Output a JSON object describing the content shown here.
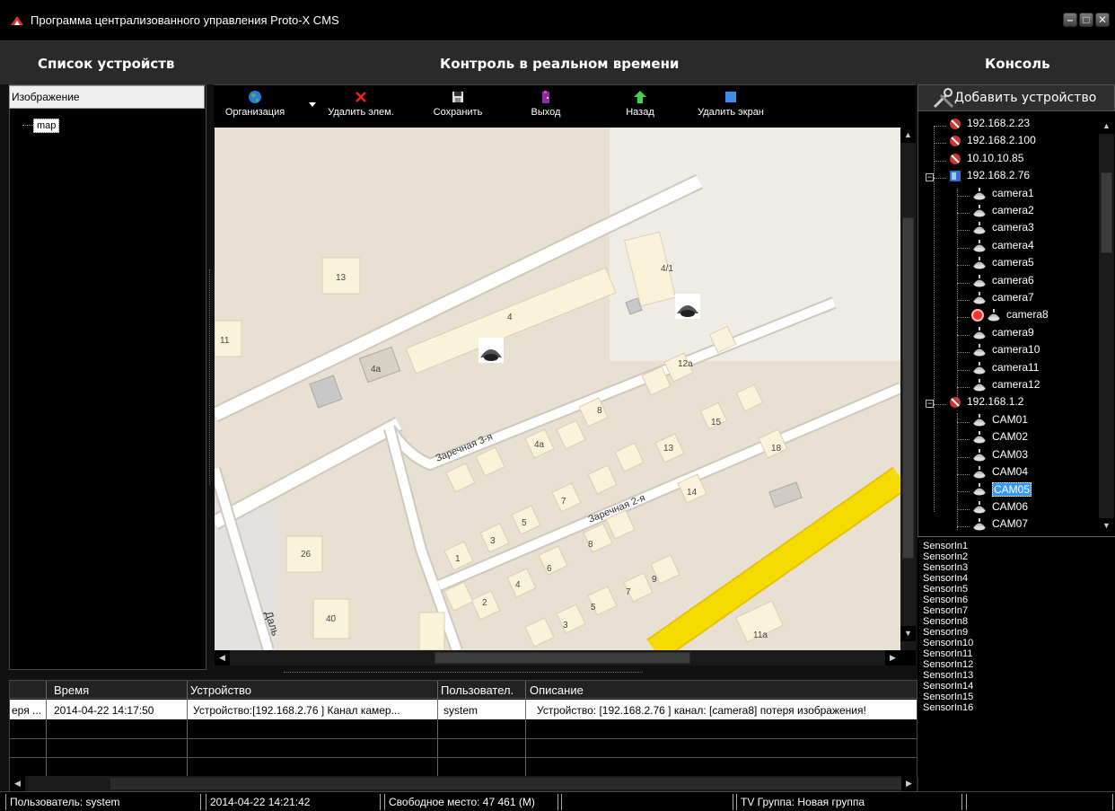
{
  "window": {
    "title": "Программа централизованного управления Proto-X CMS"
  },
  "headers": {
    "devices": "Список устройств",
    "realtime": "Контроль в реальном времени",
    "console": "Консоль"
  },
  "left": {
    "selector_value": "Изображение",
    "items": [
      "map"
    ]
  },
  "toolbar": {
    "organization": "Организация",
    "delete_item": "Удалить элем.",
    "save": "Сохранить",
    "exit": "Выход",
    "back": "Назад",
    "delete_screen": "Удалить экран"
  },
  "map": {
    "labels": [
      "13",
      "4/1",
      "4",
      "11",
      "4a",
      "12a",
      "8",
      "15",
      "4a",
      "13",
      "18",
      "7",
      "14",
      "5",
      "3",
      "8",
      "1",
      "26",
      "6",
      "9",
      "2",
      "4",
      "7",
      "5",
      "3",
      "40",
      "11a"
    ],
    "streets": [
      "Заречная 3-я",
      "Заречная 2-я",
      "Даль"
    ]
  },
  "console": {
    "add_device": "Добавить устройство",
    "tree": [
      "192.168.2.23",
      "192.168.2.100",
      "10.10.10.85",
      "192.168.2.76",
      "camera1",
      "camera2",
      "camera3",
      "camera4",
      "camera5",
      "camera6",
      "camera7",
      "camera8",
      "camera9",
      "camera10",
      "camera11",
      "camera12",
      "192.168.1.2",
      "CAM01",
      "CAM02",
      "CAM03",
      "CAM04",
      "CAM05",
      "CAM06",
      "CAM07"
    ],
    "sensors": [
      "SensorIn1",
      "SensorIn2",
      "SensorIn3",
      "SensorIn4",
      "SensorIn5",
      "SensorIn6",
      "SensorIn7",
      "SensorIn8",
      "SensorIn9",
      "SensorIn10",
      "SensorIn11",
      "SensorIn12",
      "SensorIn13",
      "SensorIn14",
      "SensorIn15",
      "SensorIn16"
    ]
  },
  "events": {
    "columns": [
      "Время",
      "Устройство",
      "Пользовател.",
      "Описание"
    ],
    "rows": [
      {
        "type": "еря ...",
        "time": "2014-04-22 14:17:50",
        "device": "Устройство:[192.168.2.76 ] Канал камер...",
        "user": "system",
        "description": "Устройство: [192.168.2.76 ] канал: [camera8] потеря изображения!"
      }
    ]
  },
  "status": {
    "user": "Пользователь: system",
    "datetime": "2014-04-22 14:21:42",
    "free_space": "Свободное место: 47 461 (M)",
    "tv_group": "TV Группа:  Новая группа"
  },
  "colors": {
    "map_road": "#ffffff",
    "map_ground": "#e8e0d2",
    "highway": "#f5dc00",
    "selection": "#3399ff"
  }
}
